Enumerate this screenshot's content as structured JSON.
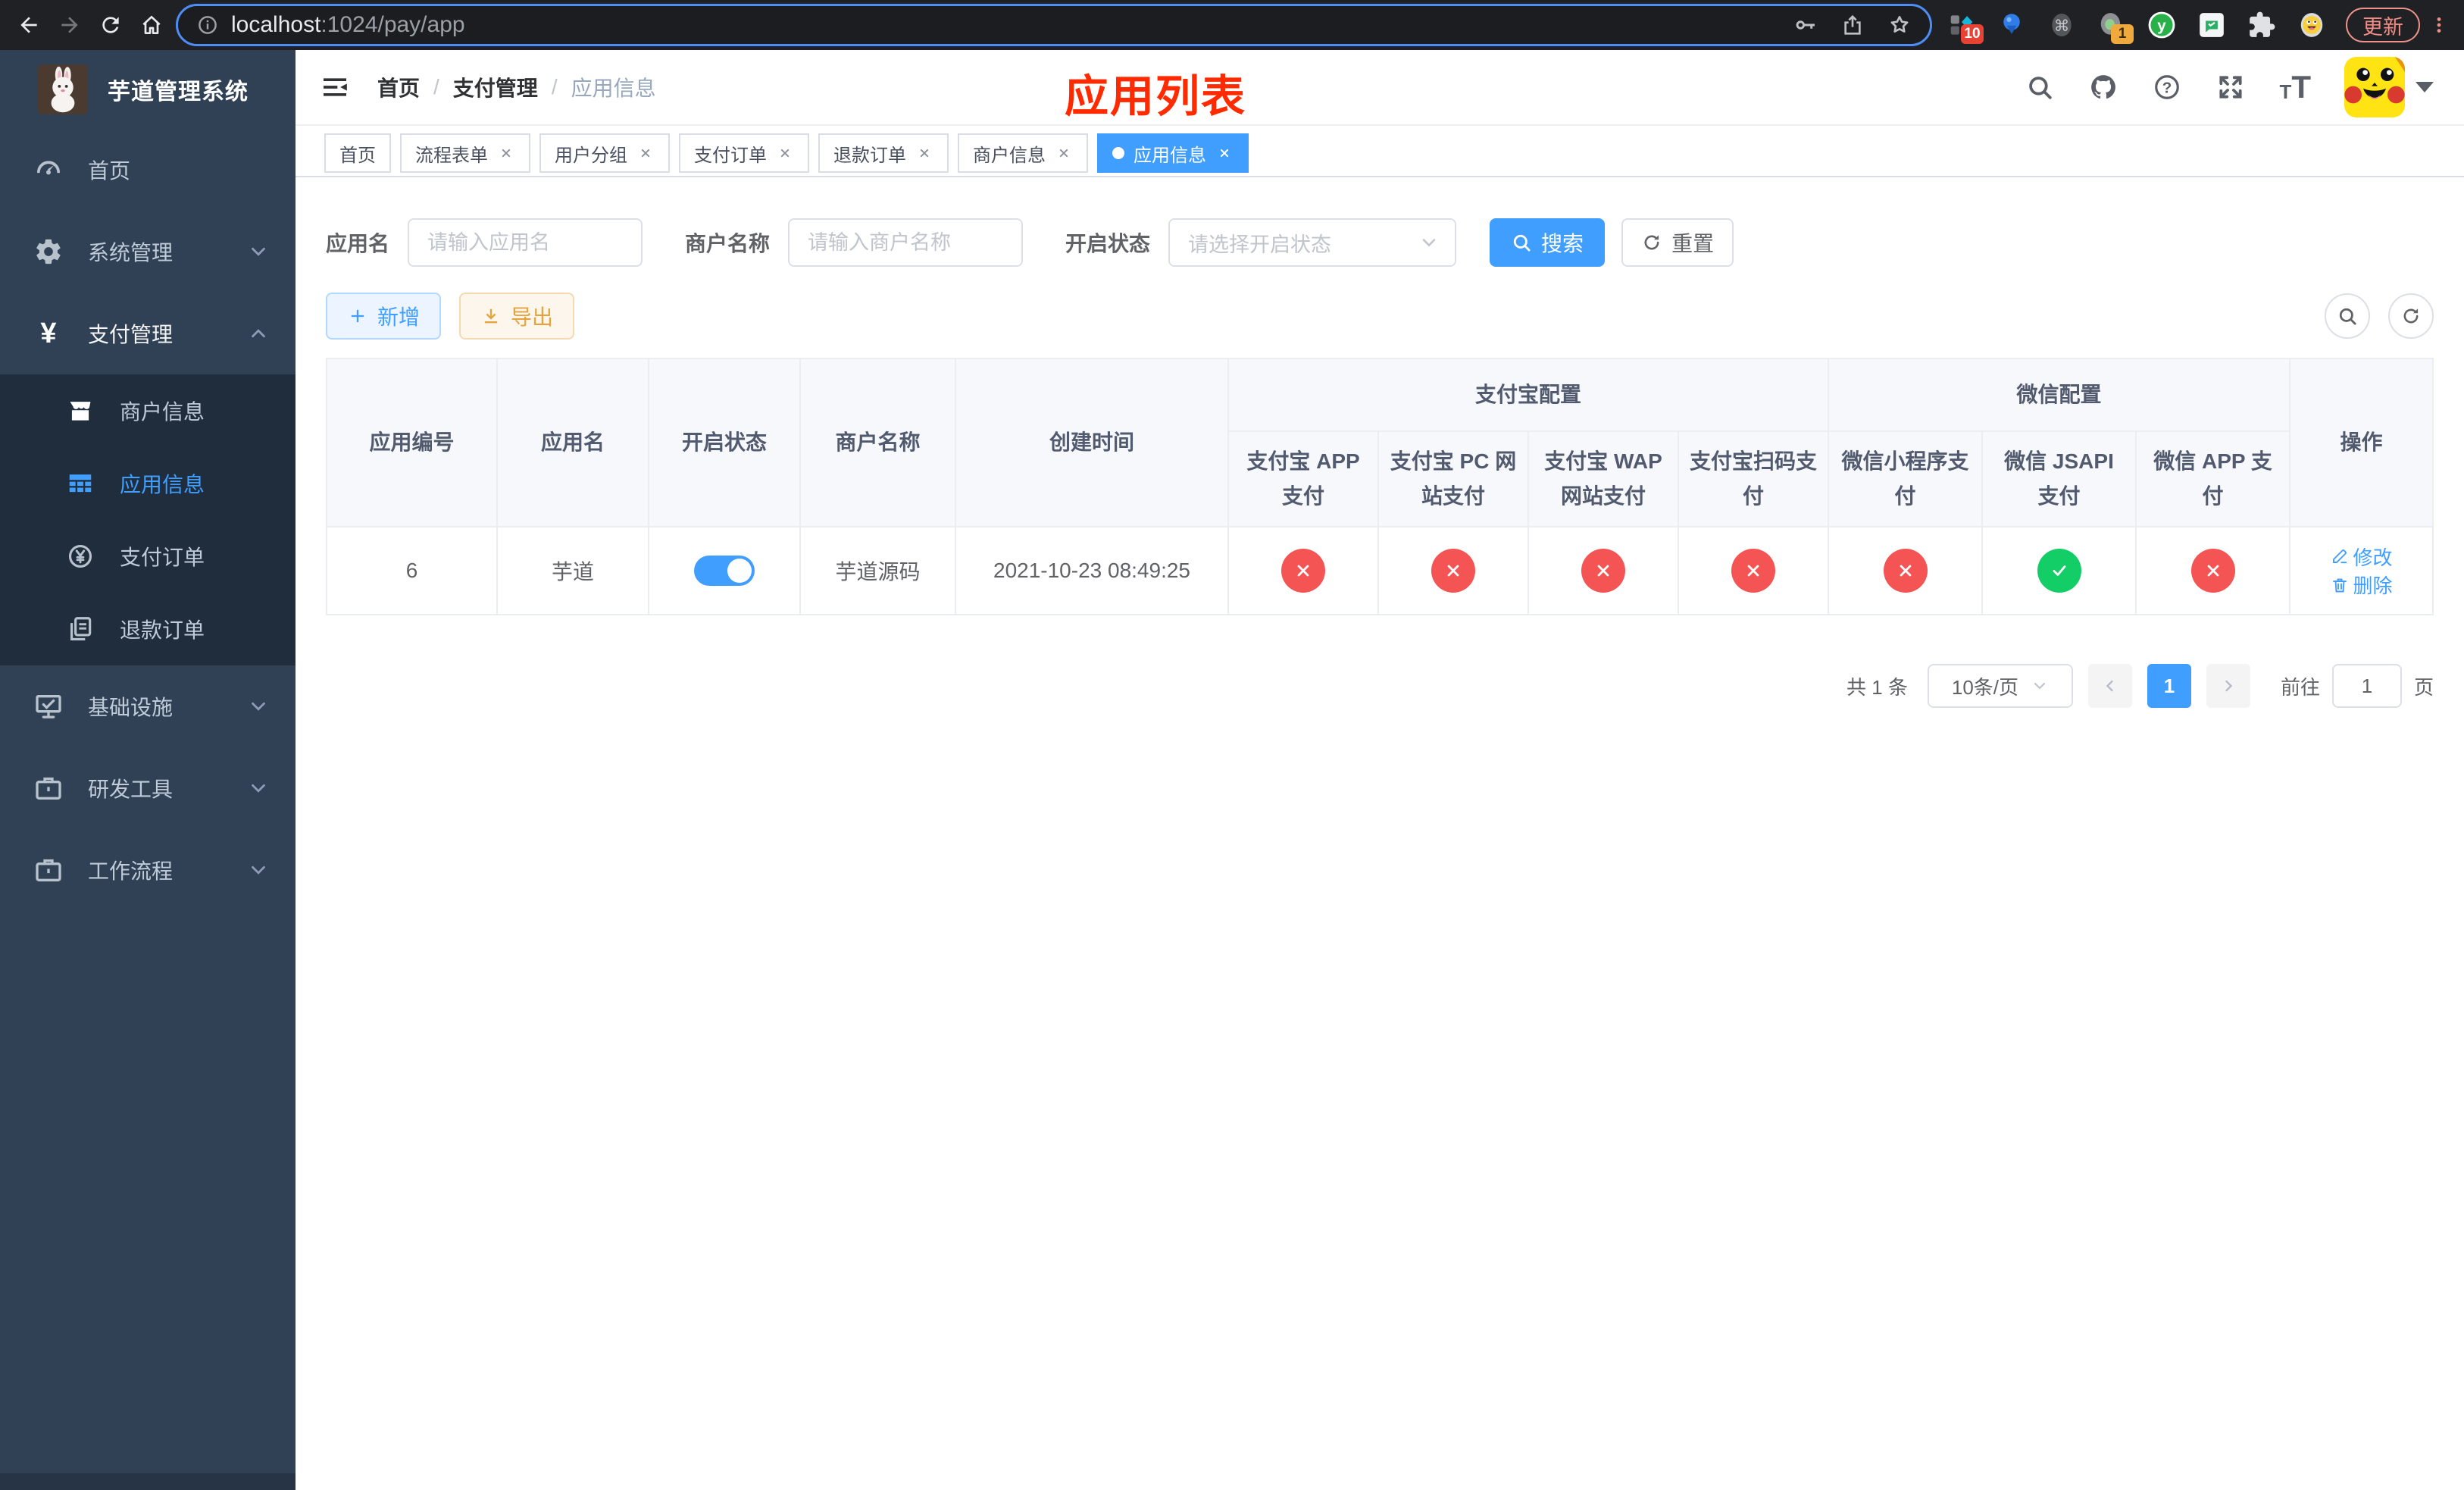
{
  "browser": {
    "url_host": "localhost",
    "url_rest": ":1024/pay/app",
    "update_label": "更新",
    "ext_badges": {
      "blue_kit": "10",
      "session": "1"
    }
  },
  "sidebar": {
    "title": "芋道管理系统",
    "items": [
      {
        "label": "首页"
      },
      {
        "label": "系统管理"
      },
      {
        "label": "支付管理"
      },
      {
        "label": "商户信息"
      },
      {
        "label": "应用信息"
      },
      {
        "label": "支付订单"
      },
      {
        "label": "退款订单"
      },
      {
        "label": "基础设施"
      },
      {
        "label": "研发工具"
      },
      {
        "label": "工作流程"
      }
    ]
  },
  "header": {
    "breadcrumb": [
      "首页",
      "支付管理",
      "应用信息"
    ],
    "separator": "/",
    "annotation": "应用列表"
  },
  "tabs": [
    {
      "label": "首页"
    },
    {
      "label": "流程表单"
    },
    {
      "label": "用户分组"
    },
    {
      "label": "支付订单"
    },
    {
      "label": "退款订单"
    },
    {
      "label": "商户信息"
    },
    {
      "label": "应用信息"
    }
  ],
  "filters": {
    "app_name_label": "应用名",
    "app_name_placeholder": "请输入应用名",
    "merchant_label": "商户名称",
    "merchant_placeholder": "请输入商户名称",
    "status_label": "开启状态",
    "status_placeholder": "请选择开启状态",
    "search_label": "搜索",
    "reset_label": "重置"
  },
  "toolbar": {
    "add_label": "新增",
    "export_label": "导出"
  },
  "table": {
    "groups": {
      "alipay": "支付宝配置",
      "wechat": "微信配置"
    },
    "headers": [
      "应用编号",
      "应用名",
      "开启状态",
      "商户名称",
      "创建时间",
      "支付宝 APP 支付",
      "支付宝 PC 网站支付",
      "支付宝 WAP 网站支付",
      "支付宝扫码支付",
      "微信小程序支付",
      "微信 JSAPI 支付",
      "微信 APP 支付",
      "操作"
    ],
    "row": {
      "id": "6",
      "name": "芋道",
      "enabled": true,
      "merchant": "芋道源码",
      "created_at": "2021-10-23 08:49:25",
      "statuses": [
        "closed",
        "closed",
        "closed",
        "closed",
        "closed",
        "enabled",
        "closed"
      ],
      "edit_label": "修改",
      "delete_label": "删除"
    }
  },
  "pagination": {
    "total": "共 1 条",
    "page_size": "10条/页",
    "current_page": "1",
    "goto_label": "前往",
    "goto_value": "1",
    "page_suffix": "页"
  },
  "colors": {
    "accent": "#409eff",
    "danger": "#f45454",
    "success": "#13ce66",
    "sidebar_bg": "#304156",
    "submenu_bg": "#1f2d3d",
    "annotation": "#ff2a00"
  }
}
